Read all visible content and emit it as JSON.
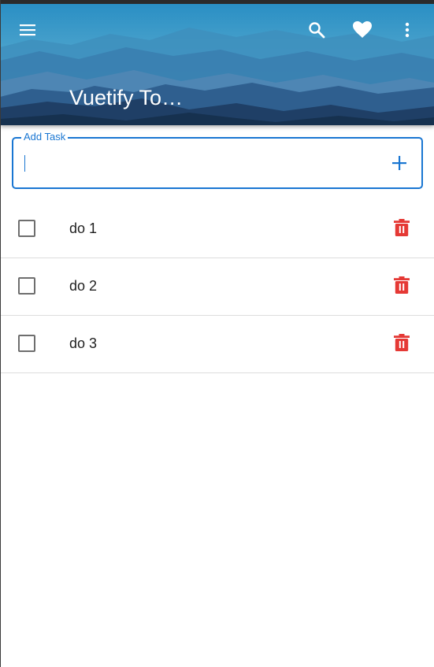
{
  "app_bar": {
    "title": "Vuetify To…",
    "icons": {
      "menu": "hamburger-menu-icon",
      "search": "search-icon",
      "favorite": "heart-icon",
      "more": "more-vertical-icon"
    },
    "colors": {
      "sky_top": "#2a8fc4",
      "sky_bottom": "#6bb6d3",
      "mountains_dark": "#16314f"
    }
  },
  "add_task": {
    "label": "Add Task",
    "value": "",
    "placeholder": "",
    "add_icon": "plus-icon",
    "accent_color": "#1976d2"
  },
  "tasks": [
    {
      "text": "do 1",
      "done": false
    },
    {
      "text": "do 2",
      "done": false
    },
    {
      "text": "do 3",
      "done": false
    }
  ],
  "delete_icon": "trash-icon",
  "delete_color": "#e53935"
}
